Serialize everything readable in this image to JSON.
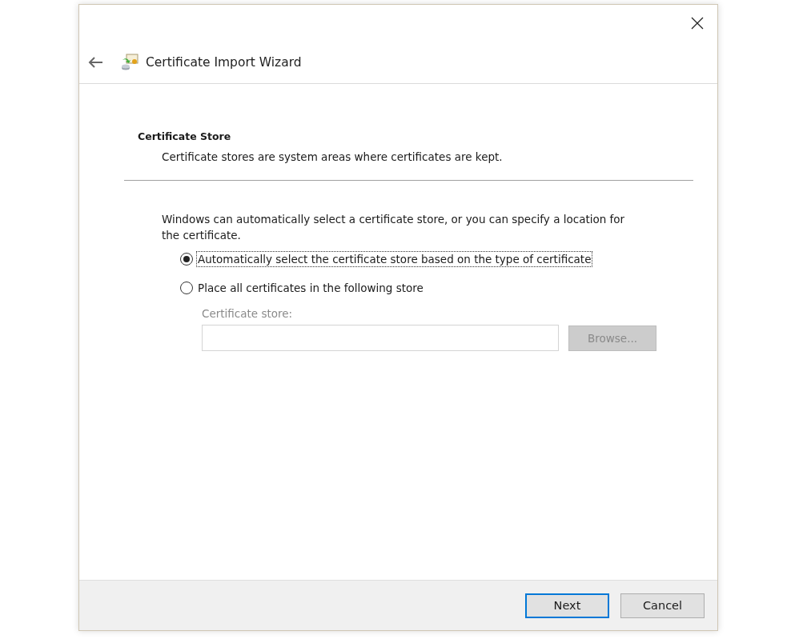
{
  "window": {
    "title": "Certificate Import Wizard"
  },
  "section": {
    "heading": "Certificate Store",
    "description": "Certificate stores are system areas where certificates are kept."
  },
  "intro": "Windows can automatically select a certificate store, or you can specify a location for the certificate.",
  "options": [
    {
      "label": "Automatically select the certificate store based on the type of certificate",
      "selected": true
    },
    {
      "label": "Place all certificates in the following store",
      "selected": false
    }
  ],
  "store": {
    "label": "Certificate store:",
    "disabled": true,
    "browse": "Browse..."
  },
  "buttons": [
    {
      "label": "Next",
      "default": true
    },
    {
      "label": "Cancel",
      "default": false
    }
  ]
}
